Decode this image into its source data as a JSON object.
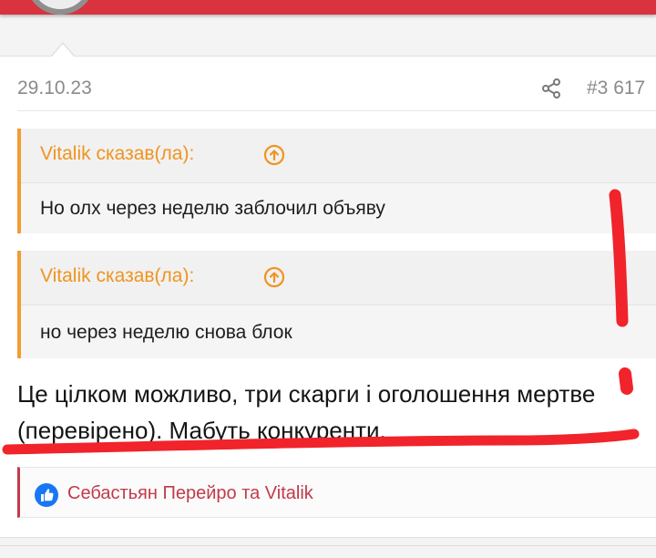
{
  "post": {
    "date": "29.10.23",
    "number": "#3 617",
    "quotes": [
      {
        "author": "Vitalik сказав(ла):",
        "text": "Но олх через неделю заблочил объяву"
      },
      {
        "author": "Vitalik сказав(ла):",
        "text": "но через неделю снова блок"
      }
    ],
    "message": "Це цілком можливо, три скарги і оголошення мертве (перевірено). Мабуть конкуренти.",
    "reactions": {
      "users": "Себастьян Перейро та Vitalik"
    }
  },
  "colors": {
    "header": "#d8333f",
    "quote_accent": "#f29c33",
    "quote_author": "#f0941f",
    "reaction_text": "#c23a4a",
    "like_icon": "#1877f2",
    "annotation": "#f1232b"
  },
  "icons": {
    "share": "share-icon",
    "quote_jump": "arrow-up-circle-icon",
    "like": "thumbs-up-icon"
  }
}
